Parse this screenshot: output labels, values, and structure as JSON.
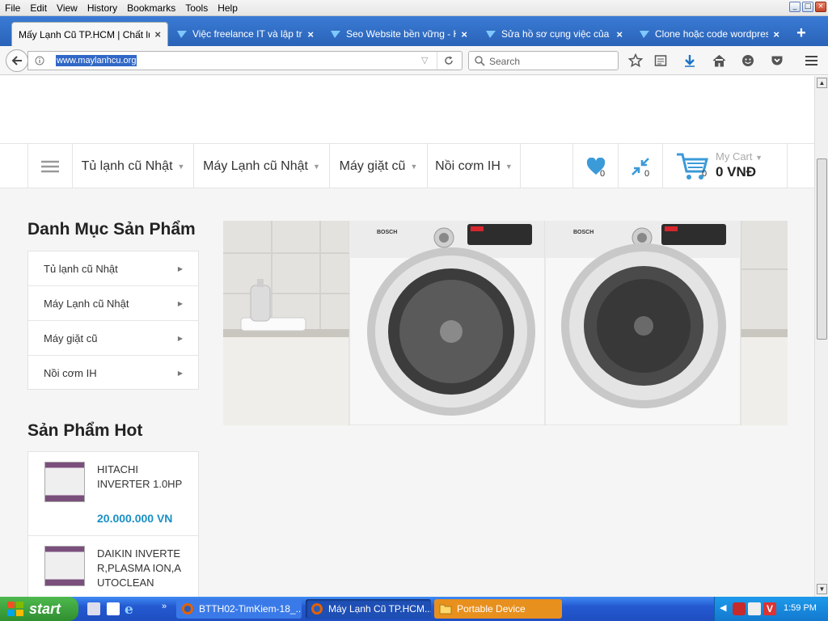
{
  "menubar": {
    "items": [
      "File",
      "Edit",
      "View",
      "History",
      "Bookmarks",
      "Tools",
      "Help"
    ]
  },
  "tabs": [
    {
      "title": "Mấy Lạnh Cũ TP.HCM | Chất lượ",
      "active": true
    },
    {
      "title": "Việc freelance IT và lập trình",
      "active": false
    },
    {
      "title": "Seo Website bền vững - Hỏi",
      "active": false
    },
    {
      "title": "Sửa hồ sơ cụng việc của bạn",
      "active": false
    },
    {
      "title": "Clone hoặc code wordpress",
      "active": false
    }
  ],
  "navbar": {
    "url": "www.maylanhcu.org",
    "search_placeholder": "Search"
  },
  "site": {
    "nav_items": [
      "Tủ lạnh cũ Nhật",
      "Máy Lạnh cũ Nhật",
      "Máy giặt cũ",
      "Nồi cơm IH"
    ],
    "wishlist_count": "0",
    "compare_count": "0",
    "cart_count": "0",
    "cart_label": "My Cart",
    "cart_total": "0 VNĐ",
    "category_heading": "Danh Mục Sản Phẩm",
    "categories": [
      "Tủ lạnh cũ Nhật",
      "Máy Lạnh cũ Nhật",
      "Máy giặt cũ",
      "Nồi cơm IH"
    ],
    "hot_heading": "Sản Phẩm Hot",
    "hot_products": [
      {
        "name": "HITACHI INVERTER 1.0HP",
        "price": "20.000.000 VN"
      },
      {
        "name": "DAIKIN INVERTER,PLASMA ION,AUTOCLEAN",
        "price": ""
      }
    ],
    "banner_brand": "BOSCH"
  },
  "taskbar": {
    "start_label": "start",
    "tasks": [
      {
        "label": "BTTH02-TimKiem-18_..."
      },
      {
        "label": "Máy Lạnh Cũ TP.HCM..."
      },
      {
        "label": "Portable Device"
      }
    ],
    "clock": "1:59 PM"
  },
  "colors": {
    "accent": "#1a8fc5",
    "tabbar": "#2a63b8",
    "taskbar": "#2459d1"
  }
}
